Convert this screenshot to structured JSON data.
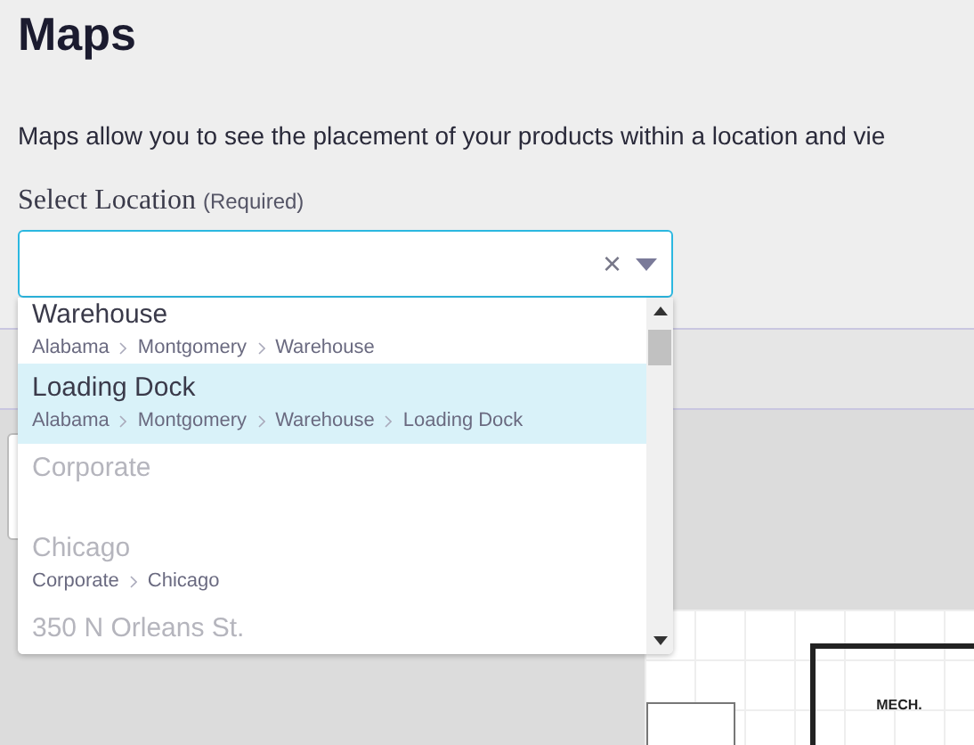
{
  "title": "Maps",
  "description": "Maps allow you to see the placement of your products within a location and vie",
  "field": {
    "label": "Select Location",
    "hint": "(Required)",
    "clear": "×"
  },
  "options": [
    {
      "name": "Warehouse",
      "path": [
        "Alabama",
        "Montgomery",
        "Warehouse"
      ],
      "selected": false,
      "disabled": false
    },
    {
      "name": "Loading Dock",
      "path": [
        "Alabama",
        "Montgomery",
        "Warehouse",
        "Loading Dock"
      ],
      "selected": true,
      "disabled": false
    },
    {
      "name": "Corporate",
      "selected": false,
      "disabled": true
    },
    {
      "name": "Chicago",
      "path": [
        "Corporate",
        "Chicago"
      ],
      "selected": false,
      "disabled": true
    },
    {
      "name": "350 N Orleans St.",
      "selected": false,
      "disabled": true
    }
  ],
  "map": {
    "room_label": "MECH."
  }
}
